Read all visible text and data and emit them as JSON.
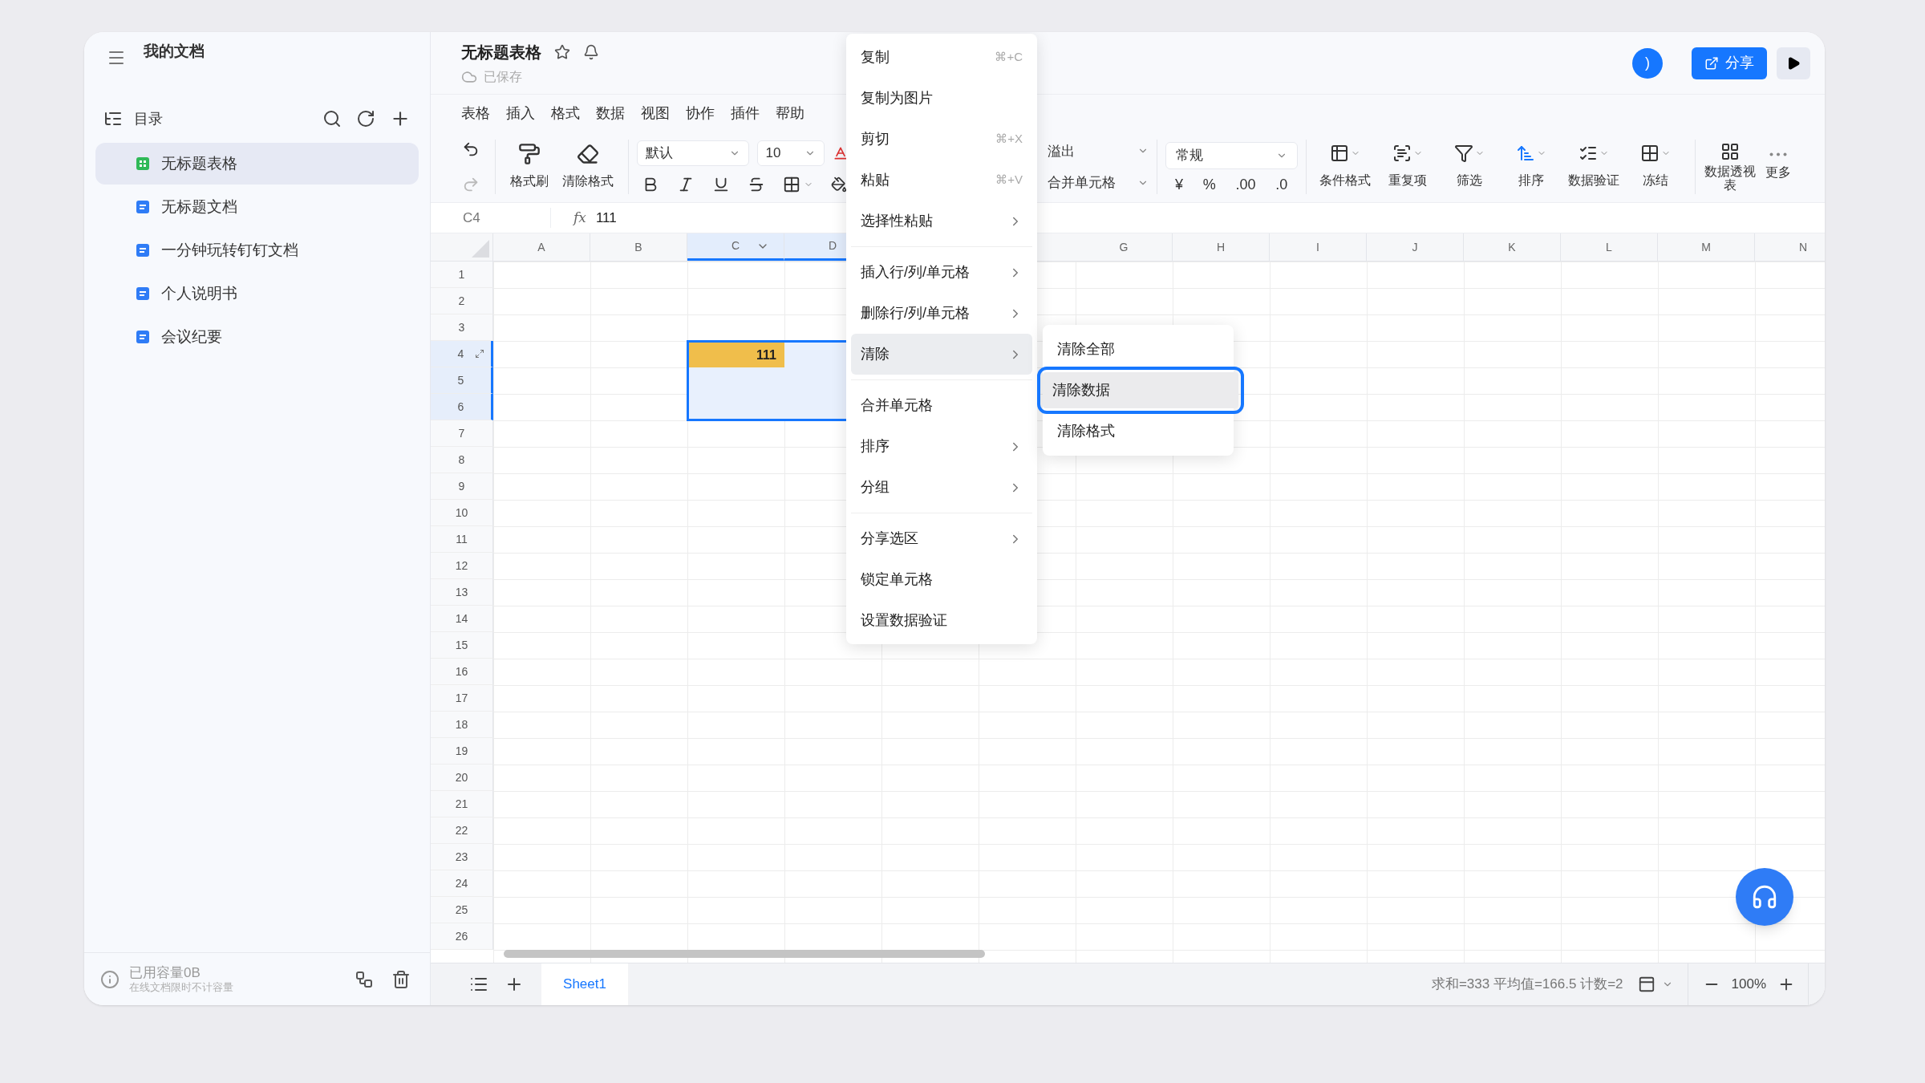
{
  "sidebar": {
    "title": "我的文档",
    "section_title": "目录",
    "items": [
      {
        "label": "无标题表格",
        "kind": "sheet",
        "selected": true
      },
      {
        "label": "无标题文档",
        "kind": "doc",
        "selected": false
      },
      {
        "label": "一分钟玩转钉钉文档",
        "kind": "doc",
        "selected": false
      },
      {
        "label": "个人说明书",
        "kind": "doc",
        "selected": false
      },
      {
        "label": "会议纪要",
        "kind": "doc",
        "selected": false
      }
    ],
    "storage": {
      "usage": "已用容量0B",
      "note": "在线文档限时不计容量"
    }
  },
  "document": {
    "title": "无标题表格",
    "status": "已保存",
    "avatar": ")",
    "share_label": "分享"
  },
  "menu_bar": [
    "表格",
    "插入",
    "格式",
    "数据",
    "视图",
    "协作",
    "插件",
    "帮助"
  ],
  "toolbar": {
    "format_painter": "格式刷",
    "clear_format": "清除格式",
    "font": "默认",
    "font_size": "10",
    "overflow": "溢出",
    "merge": "合并单元格",
    "number_format": "常规",
    "number_buttons": [
      "¥",
      "%",
      ".00",
      ".0"
    ],
    "tools": [
      "条件格式",
      "重复项",
      "筛选",
      "排序",
      "数据验证",
      "冻结"
    ],
    "pivot": "数据透视表",
    "more": "更多"
  },
  "formula_bar": {
    "cell_ref": "C4",
    "fx_label": "fx",
    "value": "111"
  },
  "grid": {
    "columns": [
      {
        "label": "A",
        "selected": false
      },
      {
        "label": "B",
        "selected": false
      },
      {
        "label": "C",
        "selected": true
      },
      {
        "label": "D",
        "selected": true
      }
    ],
    "columns_right": [
      {
        "label": "G",
        "selected": false
      },
      {
        "label": "H",
        "selected": false
      },
      {
        "label": "I",
        "selected": false
      },
      {
        "label": "J",
        "selected": false
      },
      {
        "label": "K",
        "selected": false
      },
      {
        "label": "L",
        "selected": false
      },
      {
        "label": "M",
        "selected": false
      },
      {
        "label": "N",
        "selected": false
      }
    ],
    "rows": [
      {
        "label": "1",
        "selected": false
      },
      {
        "label": "2",
        "selected": false
      },
      {
        "label": "3",
        "selected": false
      },
      {
        "label": "4",
        "selected": true
      },
      {
        "label": "5",
        "selected": true
      },
      {
        "label": "6",
        "selected": true
      },
      {
        "label": "7",
        "selected": false
      },
      {
        "label": "8",
        "selected": false
      },
      {
        "label": "9",
        "selected": false
      },
      {
        "label": "10",
        "selected": false
      },
      {
        "label": "11",
        "selected": false
      },
      {
        "label": "12",
        "selected": false
      },
      {
        "label": "13",
        "selected": false
      },
      {
        "label": "14",
        "selected": false
      },
      {
        "label": "15",
        "selected": false
      },
      {
        "label": "16",
        "selected": false
      },
      {
        "label": "17",
        "selected": false
      },
      {
        "label": "18",
        "selected": false
      },
      {
        "label": "19",
        "selected": false
      },
      {
        "label": "20",
        "selected": false
      },
      {
        "label": "21",
        "selected": false
      },
      {
        "label": "22",
        "selected": false
      },
      {
        "label": "23",
        "selected": false
      },
      {
        "label": "24",
        "selected": false
      },
      {
        "label": "25",
        "selected": false
      },
      {
        "label": "26",
        "selected": false
      }
    ],
    "active_cell_value": "111"
  },
  "sheets": [
    {
      "label": "Sheet1",
      "selected": true
    }
  ],
  "status_bar": {
    "summary": "求和=333 平均值=166.5 计数=2",
    "zoom": "100%"
  },
  "context_menu": {
    "groups": [
      [
        {
          "label": "复制",
          "shortcut": "⌘+C",
          "submenu": false,
          "selected": false
        },
        {
          "label": "复制为图片",
          "submenu": false,
          "selected": false
        },
        {
          "label": "剪切",
          "shortcut": "⌘+X",
          "submenu": false,
          "selected": false
        },
        {
          "label": "粘贴",
          "shortcut": "⌘+V",
          "submenu": false,
          "selected": false
        },
        {
          "label": "选择性粘贴",
          "submenu": true,
          "selected": false
        }
      ],
      [
        {
          "label": "插入行/列/单元格",
          "submenu": true,
          "selected": false
        },
        {
          "label": "删除行/列/单元格",
          "submenu": true,
          "selected": false
        },
        {
          "label": "清除",
          "submenu": true,
          "selected": true
        }
      ],
      [
        {
          "label": "合并单元格",
          "submenu": false,
          "selected": false
        },
        {
          "label": "排序",
          "submenu": true,
          "selected": false
        },
        {
          "label": "分组",
          "submenu": true,
          "selected": false
        }
      ],
      [
        {
          "label": "分享选区",
          "submenu": true,
          "selected": false
        },
        {
          "label": "锁定单元格",
          "submenu": false,
          "selected": false
        },
        {
          "label": "设置数据验证",
          "submenu": false,
          "selected": false
        }
      ]
    ]
  },
  "submenu": {
    "items": [
      {
        "label": "清除全部",
        "selected": false
      },
      {
        "label": "清除数据",
        "selected": true
      },
      {
        "label": "清除格式",
        "selected": false
      }
    ]
  }
}
